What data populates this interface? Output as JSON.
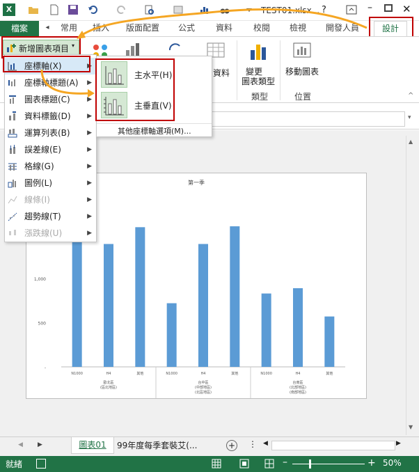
{
  "qat": {
    "title": "TEST01.xlsx..."
  },
  "tabs": {
    "file": "檔案",
    "items": [
      "常用",
      "插入",
      "版面配置",
      "公式",
      "資料",
      "校閱",
      "檢視",
      "開發人員"
    ],
    "design": "設計"
  },
  "ribbon": {
    "add_element": "新增圖表項目",
    "group_data": "資料",
    "change_type_line1": "變更",
    "change_type_line2": "圖表類型",
    "group_type": "類型",
    "move_chart": "移動圖表",
    "group_location": "位置"
  },
  "menu": {
    "items": [
      {
        "label": "座標軸(X)",
        "disabled": false
      },
      {
        "label": "座標軸標題(A)",
        "disabled": false
      },
      {
        "label": "圖表標題(C)",
        "disabled": false
      },
      {
        "label": "資料標籤(D)",
        "disabled": false
      },
      {
        "label": "運算列表(B)",
        "disabled": false
      },
      {
        "label": "誤差線(E)",
        "disabled": false
      },
      {
        "label": "格線(G)",
        "disabled": false
      },
      {
        "label": "圖例(L)",
        "disabled": false
      },
      {
        "label": "線條(I)",
        "disabled": true
      },
      {
        "label": "趨勢線(T)",
        "disabled": false
      },
      {
        "label": "漲跌線(U)",
        "disabled": true
      }
    ]
  },
  "submenu": {
    "horizontal": "主水平(H)",
    "vertical": "主垂直(V)",
    "more": "其他座標軸選項(M)..."
  },
  "chart": {
    "title": "第一季"
  },
  "chart_data": {
    "type": "bar",
    "title": "第一季",
    "categories": [
      "N1000",
      "H4",
      "其他",
      "N1000",
      "H4",
      "其他",
      "N1000",
      "H4",
      "其他"
    ],
    "groups": [
      {
        "label": "歐北區",
        "sub": "(區北地區)"
      },
      {
        "label": "台中區",
        "sub": "(中部地區)",
        "sub2": "(北區地區)"
      },
      {
        "label": "台南區",
        "sub": "(北部地區)",
        "sub2": "(南部地區)"
      }
    ],
    "values": [
      1820,
      1390,
      1580,
      720,
      1390,
      1590,
      830,
      890,
      570
    ],
    "yticks": [
      "-",
      "500",
      "1,000",
      "1,500"
    ],
    "ylim": [
      0,
      2000
    ],
    "color": "#5b9bd5"
  },
  "sheet_tabs": {
    "tab1": "圖表01",
    "tab2": "99年度每季套裝艾(..."
  },
  "status": {
    "ready": "就緒",
    "zoom": "50%"
  }
}
